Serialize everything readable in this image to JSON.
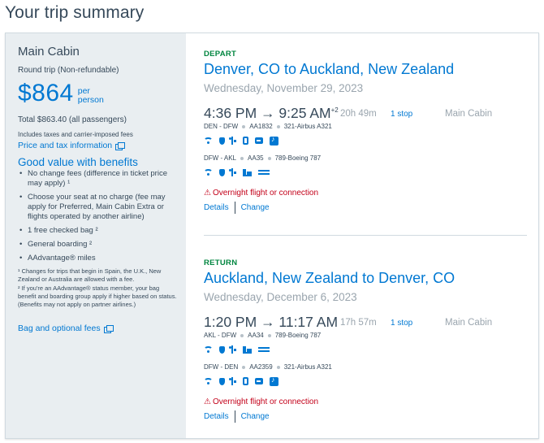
{
  "page_title": "Your trip summary",
  "summary": {
    "cabin_name": "Main Cabin",
    "trip_type": "Round trip (Non-refundable)",
    "price": "$864",
    "per": "per",
    "person": "person",
    "total": "Total $863.40 (all passengers)",
    "includes": "Includes taxes and carrier-imposed fees",
    "price_tax_link": "Price and tax information",
    "benefits_title": "Good value with benefits",
    "benefits": [
      "No change fees (difference in ticket price may apply) ¹",
      "Choose your seat at no charge (fee may apply for Preferred, Main Cabin Extra or flights operated by another airline)",
      "1 free checked bag ²",
      "General boarding ²",
      "AAdvantage® miles"
    ],
    "footnote_1": "¹ Changes for trips that begin in Spain, the U.K., New Zealand or Australia are allowed with a fee.",
    "footnote_2": "² If you're an AAdvantage® status member, your bag benefit and boarding group apply if higher based on status. (Benefits may not apply on partner airlines.)",
    "bag_link": "Bag and optional fees"
  },
  "depart": {
    "label": "DEPART",
    "route": "Denver, CO to Auckland, New Zealand",
    "date": "Wednesday, November 29, 2023",
    "times": "4:36 PM  →  9:25 AM",
    "day_offset": "+2",
    "duration": "20h 49m",
    "stops": "1 stop",
    "cabin": "Main Cabin",
    "legs": [
      {
        "route": "DEN - DFW",
        "flight": "AA1832",
        "aircraft": "321-Airbus A321",
        "amenities": [
          "wifi-icon",
          "shield-icon",
          "usb-icon",
          "power-icon",
          "screen-icon",
          "media-icon"
        ]
      },
      {
        "route": "DFW - AKL",
        "flight": "AA35",
        "aircraft": "789-Boeing 787",
        "amenities": [
          "wifi-icon",
          "shield-icon",
          "usb-icon",
          "bed-icon",
          "lie-flat-icon"
        ]
      }
    ],
    "overnight": "Overnight flight or connection",
    "details": "Details",
    "change": "Change"
  },
  "return": {
    "label": "RETURN",
    "route": "Auckland, New Zealand to Denver, CO",
    "date": "Wednesday, December 6, 2023",
    "times": "1:20 PM  →  11:17 AM",
    "duration": "17h 57m",
    "stops": "1 stop",
    "cabin": "Main Cabin",
    "legs": [
      {
        "route": "AKL - DFW",
        "flight": "AA34",
        "aircraft": "789-Boeing 787",
        "amenities": [
          "wifi-icon",
          "shield-icon",
          "usb-icon",
          "bed-icon",
          "lie-flat-icon"
        ]
      },
      {
        "route": "DFW - DEN",
        "flight": "AA2359",
        "aircraft": "321-Airbus A321",
        "amenities": [
          "wifi-icon",
          "shield-icon",
          "usb-icon",
          "power-icon",
          "screen-icon",
          "media-icon"
        ]
      }
    ],
    "overnight": "Overnight flight or connection",
    "details": "Details",
    "change": "Change"
  },
  "colors": {
    "accent": "#0078d2",
    "depart_green": "#00853f",
    "warning_red": "#c30019",
    "text": "#36495a",
    "panel": "#e9eef1"
  }
}
